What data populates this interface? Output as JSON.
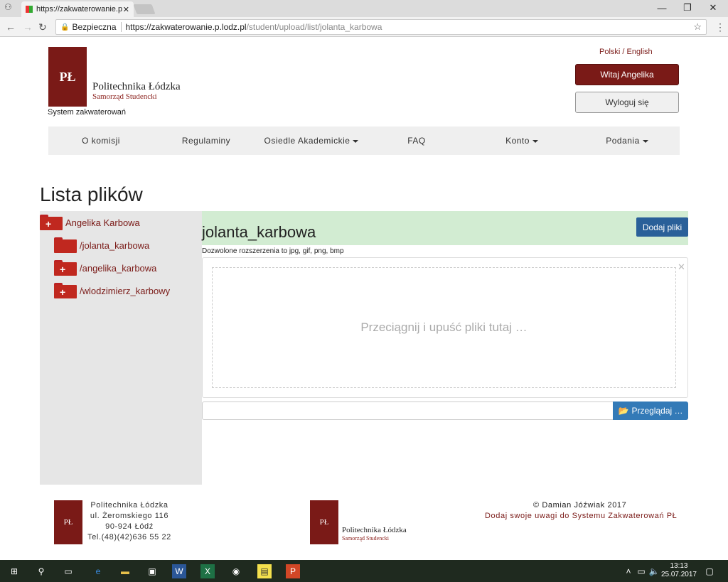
{
  "browser": {
    "tab_title": "https://zakwaterowanie.p",
    "secure_label": "Bezpieczna",
    "url_host": "https://zakwaterowanie.p.lodz.pl",
    "url_path": "/student/upload/list/jolanta_karbowa"
  },
  "header": {
    "logo_text": "PŁ",
    "brand_name": "Politechnika Łódzka",
    "brand_sub": "Samorząd Studencki",
    "system_name": "System zakwaterowań",
    "lang": "Polski / English",
    "welcome_button": "Witaj Angelika",
    "logout_button": "Wyloguj się"
  },
  "nav": {
    "items": [
      {
        "label": "O komisji"
      },
      {
        "label": "Regulaminy"
      },
      {
        "label": "Osiedle Akademickie"
      },
      {
        "label": "FAQ"
      },
      {
        "label": "Konto"
      },
      {
        "label": "Podania"
      }
    ]
  },
  "page": {
    "title": "Lista plików"
  },
  "tree": {
    "root": "Angelika Karbowa",
    "children": [
      {
        "label": "/jolanta_karbowa"
      },
      {
        "label": "/angelika_karbowa"
      },
      {
        "label": "/wlodzimierz_karbowy"
      }
    ]
  },
  "content": {
    "folder_title": "jolanta_karbowa",
    "add_button": "Dodaj pliki",
    "allowed_ext": "Dozwolone rozszerzenia to jpg, gif, png, bmp",
    "drop_text": "Przeciągnij i upuść pliki tutaj …",
    "browse_button": "Przeglądaj …"
  },
  "footer": {
    "logo_text": "PŁ",
    "address": [
      "Politechnika Łódzka",
      "ul. Żeromskiego 116",
      "90-924 Łódź",
      "Tel.(48)(42)636 55 22"
    ],
    "brand_name": "Politechnika Łódzka",
    "brand_sub": "Samorząd Studencki",
    "copyright": "© Damian Jóźwiak 2017",
    "feedback_link": "Dodaj swoje uwagi do Systemu Zakwaterowań PŁ"
  },
  "taskbar": {
    "time": "13:13",
    "date": "25.07.2017"
  }
}
